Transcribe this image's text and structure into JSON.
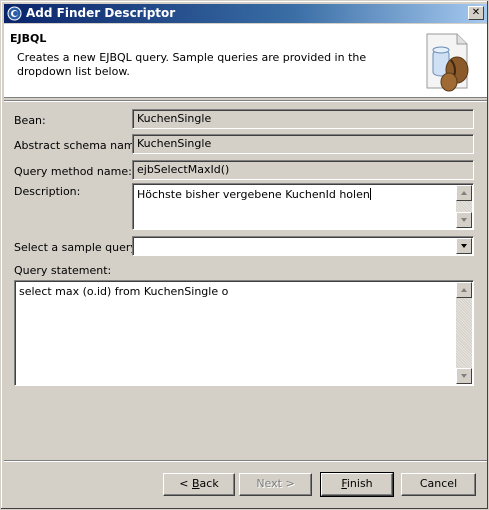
{
  "window": {
    "title": "Add Finder Descriptor",
    "close_glyph": "✕"
  },
  "banner": {
    "heading": "EJBQL",
    "description": "Creates a new EJBQL query.  Sample queries are provided in the dropdown list below.",
    "icon": "ejb-bean-icon"
  },
  "form": {
    "bean_label": "Bean:",
    "bean_value": "KuchenSingle",
    "schema_label": "Abstract schema name:",
    "schema_value": "KuchenSingle",
    "method_label": "Query method name:",
    "method_value": "ejbSelectMaxId()",
    "description_label": "Description:",
    "description_value": "Höchste bisher vergebene KuchenId holen",
    "sample_label": "Select a sample query:",
    "sample_value": "",
    "statement_label": "Query statement:",
    "statement_value": "select max (o.id) from KuchenSingle o"
  },
  "buttons": {
    "back_prefix": "< ",
    "back_mnemonic": "B",
    "back_rest": "ack",
    "next": "Next >",
    "finish_mnemonic": "F",
    "finish_rest": "inish",
    "cancel": "Cancel"
  },
  "colors": {
    "titlebar_start": "#0a246a",
    "titlebar_end": "#a6caf0",
    "face": "#d4d0c8"
  }
}
